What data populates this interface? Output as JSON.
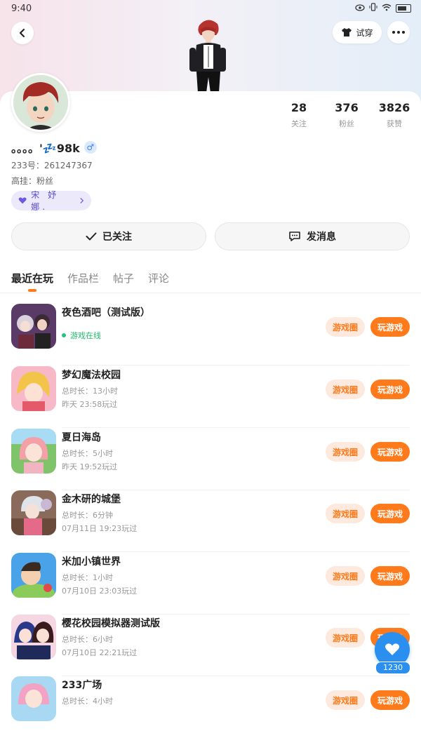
{
  "status": {
    "time": "9:40"
  },
  "header": {
    "tryon_label": "试穿"
  },
  "profile": {
    "nickname": "。。。。'💤98k",
    "gender": "♂",
    "uid": "233号：261247367",
    "hook": "高挂：粉丝",
    "fan_badge": "宋 妤 娜."
  },
  "stats": [
    {
      "value": "28",
      "label": "关注"
    },
    {
      "value": "376",
      "label": "粉丝"
    },
    {
      "value": "3826",
      "label": "获赞"
    }
  ],
  "actions": {
    "followed_label": "已关注",
    "message_label": "发消息"
  },
  "tabs": [
    "最近在玩",
    "作品栏",
    "帖子",
    "评论"
  ],
  "game_actions": {
    "circle_label": "游戏圈",
    "play_label": "玩游戏"
  },
  "games": [
    {
      "title": "夜色酒吧（测试版）",
      "status": "游戏在线",
      "duration": "",
      "last": "",
      "icon_color": "#6b4a7a"
    },
    {
      "title": "梦幻魔法校园",
      "status": "",
      "duration": "总时长：13小时",
      "last": "昨天 23:58玩过",
      "icon_color": "#f4a7b9"
    },
    {
      "title": "夏日海岛",
      "status": "",
      "duration": "总时长：5小时",
      "last": "昨天 19:52玩过",
      "icon_color": "#e9b0a5"
    },
    {
      "title": "金木研的城堡",
      "status": "",
      "duration": "总时长：6分钟",
      "last": "07月11日 19:23玩过",
      "icon_color": "#b7a2b6"
    },
    {
      "title": "米加小镇世界",
      "status": "",
      "duration": "总时长：1小时",
      "last": "07月10日 23:03玩过",
      "icon_color": "#4aa3e8"
    },
    {
      "title": "樱花校园模拟器测试版",
      "status": "",
      "duration": "总时长：6小时",
      "last": "07月10日 22:21玩过",
      "icon_color": "#d75a8a"
    },
    {
      "title": "233广场",
      "status": "",
      "duration": "总时长：4小时",
      "last": "",
      "icon_color": "#f2a3c3"
    }
  ],
  "likes": {
    "count": "1230"
  }
}
